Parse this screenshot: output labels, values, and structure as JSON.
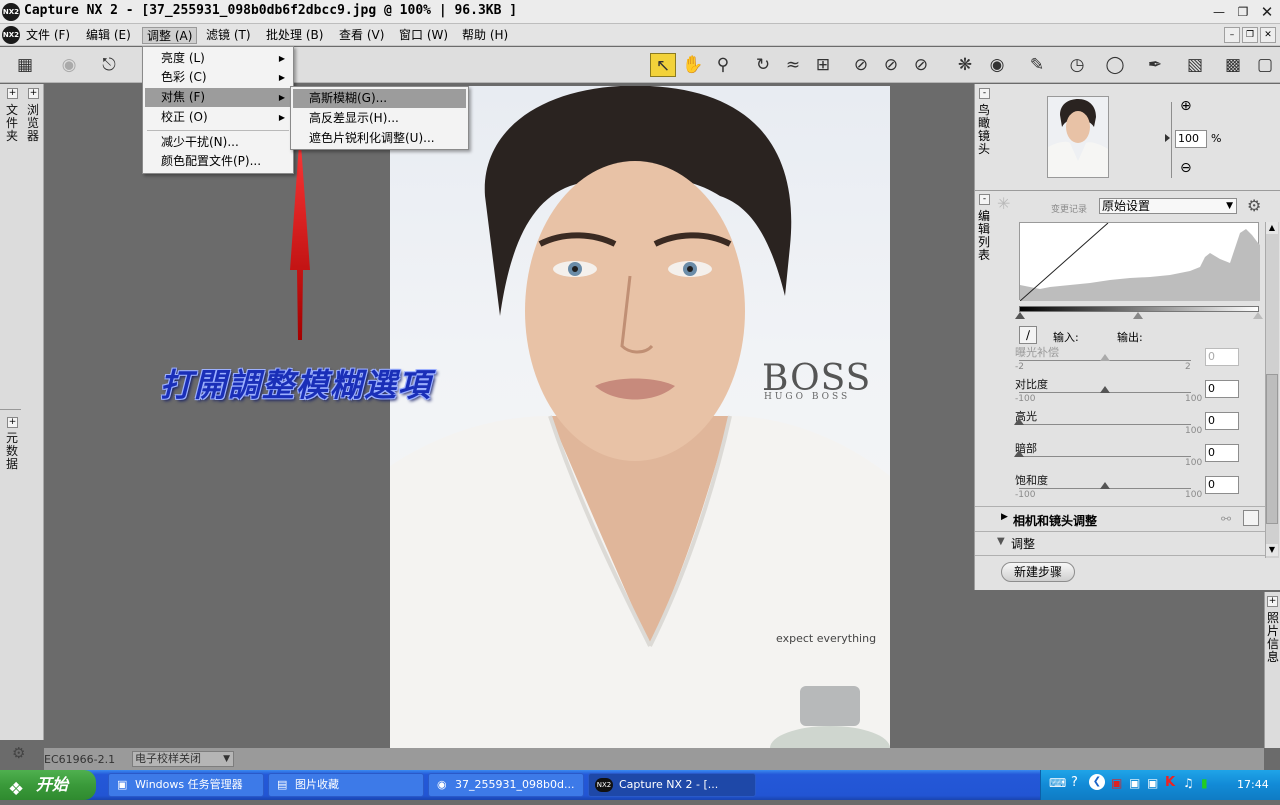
{
  "window": {
    "title": "Capture  NX 2 - [37_255931_098b0db6f2dbcc9.jpg @ 100% | 96.3KB ]",
    "app_logo": "NX2"
  },
  "menubar": {
    "items": [
      "文件 (F)",
      "编辑 (E)",
      "调整 (A)",
      "滤镜 (T)",
      "批处理 (B)",
      "查看 (V)",
      "窗口 (W)",
      "帮助 (H)"
    ],
    "active": "调整 (A)"
  },
  "menu_adjust": {
    "items": [
      "亮度 (L)",
      "色彩 (C)",
      "对焦 (F)",
      "校正 (O)",
      "减少干扰(N)...",
      "颜色配置文件(P)..."
    ],
    "highlighted": "对焦 (F)"
  },
  "submenu_focus": {
    "items": [
      "高斯模糊(G)...",
      "高反差显示(H)...",
      "遮色片锐利化调整(U)..."
    ],
    "highlighted": "高斯模糊(G)..."
  },
  "annotation": {
    "text": "打開調整模糊選項",
    "color": "#1a2fb8"
  },
  "left_tabs": {
    "folders": "文件夹",
    "browser": "浏览器",
    "metadata": "元数据"
  },
  "photo": {
    "brand_main": "BOSS",
    "brand_sub": "HUGO BOSS",
    "tagline": "expect everything"
  },
  "birds_eye": {
    "label": "鸟瞰镜头",
    "zoom_value": "100",
    "zoom_unit": "%"
  },
  "edit_list": {
    "label": "编辑列表",
    "history_label": "变更记录",
    "preset": "原始设置",
    "input_label": "输入:",
    "output_label": "输出:",
    "sliders": [
      {
        "name": "曝光补偿",
        "min": "-2",
        "max": "2",
        "value": "0",
        "position": 0.5,
        "disabled": true
      },
      {
        "name": "对比度",
        "min": "-100",
        "max": "100",
        "value": "0",
        "position": 0.5,
        "disabled": false
      },
      {
        "name": "高光",
        "min": "",
        "max": "100",
        "value": "0",
        "position": 0.0,
        "disabled": false
      },
      {
        "name": "暗部",
        "min": "",
        "max": "100",
        "value": "0",
        "position": 0.0,
        "disabled": false
      },
      {
        "name": "饱和度",
        "min": "-100",
        "max": "100",
        "value": "0",
        "position": 0.5,
        "disabled": false
      }
    ],
    "section_camera": "相机和镜头调整",
    "section_adjust": "调整",
    "new_step": "新建步骤"
  },
  "photo_info": {
    "label": "照片信息"
  },
  "statusbar": {
    "left": "EC61966-2.1",
    "soft_proof": "电子校样关闭"
  },
  "taskbar": {
    "start": "开始",
    "tasks": [
      {
        "label": "Windows 任务管理器",
        "active": false
      },
      {
        "label": "图片收藏",
        "active": false
      },
      {
        "label": "37_255931_098b0d...",
        "active": false
      },
      {
        "label": "Capture NX 2 - [...",
        "active": true
      }
    ],
    "clock": "17:44"
  },
  "colors": {
    "accent_yellow": "#f2d23a",
    "taskbar_blue": "#2255d4",
    "start_green": "#3a9a3a",
    "arrow_red": "#d81818"
  }
}
